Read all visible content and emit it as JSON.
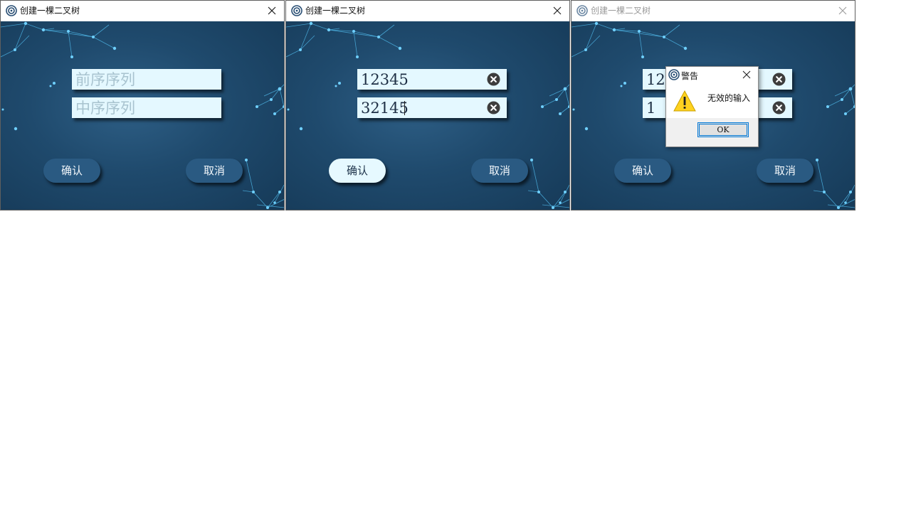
{
  "window_title": "创建一棵二叉树",
  "labels": {
    "preorder_placeholder": "前序序列",
    "inorder_placeholder": "中序序列",
    "confirm": "确认",
    "cancel": "取消"
  },
  "panels": [
    {
      "state": "empty",
      "preorder_value": "",
      "inorder_value": ""
    },
    {
      "state": "filled",
      "preorder_value": "12345",
      "inorder_value": "32145"
    },
    {
      "state": "error",
      "preorder_value": "12",
      "inorder_value": "1"
    }
  ],
  "warning_dialog": {
    "title": "警告",
    "message": "无效的输入",
    "ok": "OK"
  },
  "icons": {
    "app": "target-swirl-icon",
    "close": "close-icon",
    "clear": "clear-input-icon",
    "warning": "warning-triangle-icon"
  },
  "colors": {
    "background_dark": "#163a58",
    "background_mid": "#2e5f86",
    "button": "#2a5a82",
    "field": "#e4f8ff",
    "network_node": "#4fc3f7"
  }
}
